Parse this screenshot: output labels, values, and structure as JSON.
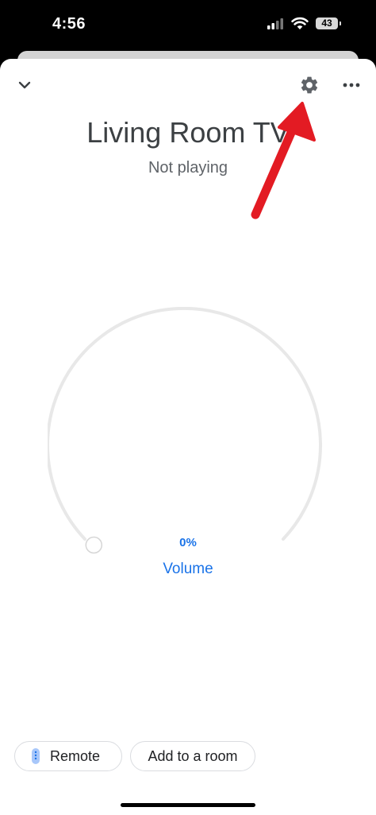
{
  "status_bar": {
    "time": "4:56",
    "battery": "43",
    "signal_icon": "cellular-signal-icon",
    "wifi_icon": "wifi-icon"
  },
  "header": {
    "collapse_icon": "chevron-down-icon",
    "settings_icon": "gear-icon",
    "more_icon": "more-horizontal-icon"
  },
  "device": {
    "name": "Living Room TV",
    "status": "Not playing"
  },
  "volume": {
    "value_text": "0%",
    "level": 0,
    "label": "Volume"
  },
  "actions": {
    "remote_label": "Remote",
    "remote_icon": "remote-icon",
    "add_room_label": "Add to a room"
  },
  "colors": {
    "accent": "#1a73e8",
    "annotation_arrow": "#e31b23",
    "dial_track": "#e8e8e8"
  }
}
